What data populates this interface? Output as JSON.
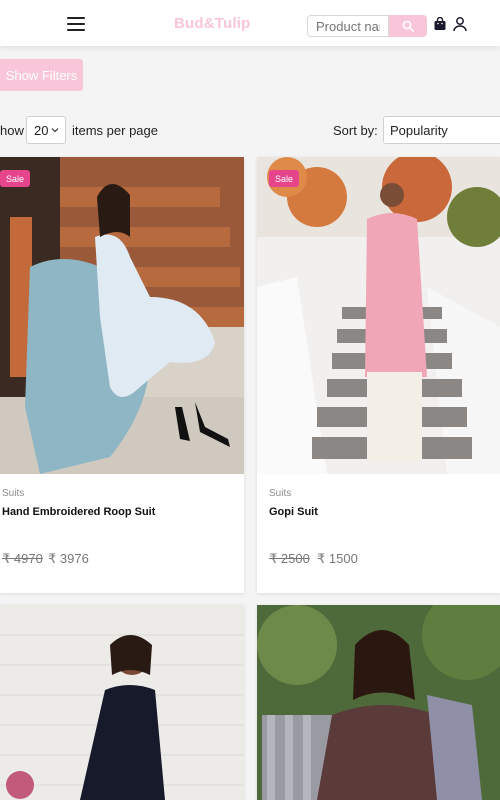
{
  "header": {
    "logo": "Bud&Tulip",
    "search_placeholder": "Product name",
    "icons": [
      "menu-icon",
      "search-icon",
      "shopping-bag-icon",
      "user-icon"
    ]
  },
  "toolbar": {
    "filter_label": "Show Filters",
    "show_label": "how",
    "per_page_value": "20",
    "per_page_suffix": "items per page",
    "sort_label": "Sort by:",
    "sort_value": "Popularity"
  },
  "products": [
    {
      "badge": "Sale",
      "category": "Suits",
      "name": "Hand Embroidered Roop Suit",
      "old_price": "₹ 4970",
      "price": "₹ 3976"
    },
    {
      "badge": "Sale",
      "category": "Suits",
      "name": "Gopi Suit",
      "old_price": "₹ 2500",
      "price": "₹ 1500"
    },
    {
      "badge": "",
      "category": "",
      "name": "",
      "old_price": "",
      "price": ""
    },
    {
      "badge": "",
      "category": "",
      "name": "",
      "old_price": "",
      "price": ""
    }
  ],
  "colors": {
    "brand_pink": "#f9c6d9",
    "sale_badge": "#e6458b",
    "text": "#222222",
    "muted": "#777777"
  }
}
